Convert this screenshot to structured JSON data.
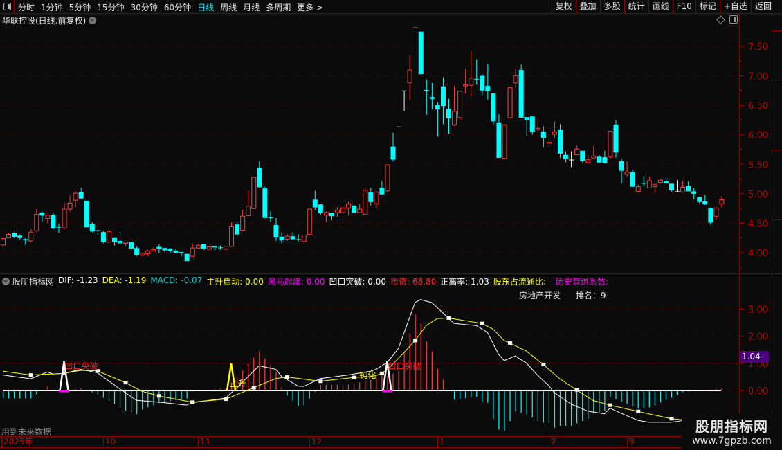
{
  "toolbar": {
    "periods": [
      "分时",
      "1分钟",
      "5分钟",
      "15分钟",
      "30分钟",
      "60分钟",
      "日线",
      "周线",
      "月线",
      "多周期",
      "更多 >"
    ],
    "active_period": "日线",
    "buttons": [
      "复权",
      "叠加",
      "多股",
      "统计",
      "画线",
      "F10",
      "标记",
      "+自选",
      "返回"
    ]
  },
  "main_panel": {
    "title": "华联控股(日线.前复权)"
  },
  "macd_panel": {
    "indicator_name": "股朋指标网",
    "fields": [
      {
        "label": "DIF: -1.23",
        "color": "#ffffff"
      },
      {
        "label": "DEA: -1.19",
        "color": "#ffff00"
      },
      {
        "label": "MACD: -0.07",
        "color": "#00c8c8"
      },
      {
        "label": "主升启动: 0.00",
        "color": "#ffff00"
      },
      {
        "label": "黑马起爆: 0.00",
        "color": "#ff00ff"
      },
      {
        "label": "凹口突破: 0.00",
        "color": "#ffffff"
      },
      {
        "label": "市值: 68.80",
        "color": "#ff2020"
      },
      {
        "label": "正离率: 1.03",
        "color": "#ffffff"
      },
      {
        "label": "股东占流通比: -",
        "color": "#ffff00"
      },
      {
        "label": "历史衰退系数: -",
        "color": "#ff00ff"
      }
    ],
    "sector": "房地产开发",
    "rank": "排名：9",
    "current_value_badge": "1.04",
    "future_data_note": "用到未来数据",
    "signal_labels": {
      "breakout": "凹口突破",
      "main_rise": "主升",
      "dulled": "钝化"
    }
  },
  "date_axis": [
    {
      "label": "2025年",
      "index": 0
    },
    {
      "label": "10",
      "index": 18
    },
    {
      "label": "11",
      "index": 35
    },
    {
      "label": "12",
      "index": 55
    },
    {
      "label": "1",
      "index": 78
    },
    {
      "label": "2",
      "index": 98
    },
    {
      "label": "3",
      "index": 112
    }
  ],
  "watermark": {
    "title": "股朋指标网",
    "url": "www.7gpzb.com"
  },
  "colors": {
    "up": "#ff3c3c",
    "down": "#00ffff",
    "flat": "#ffffff",
    "axis": "#c00000",
    "dif": "#ffffff",
    "dea": "#ffff00"
  },
  "chart_data": [
    {
      "type": "candlestick",
      "title": "华联控股(日线.前复权)",
      "y_ticks": [
        "7.50",
        "7.00",
        "6.50",
        "6.00",
        "5.50",
        "5.00",
        "4.50",
        "4.00"
      ],
      "ylim": [
        3.7,
        7.85
      ],
      "ohlc": [
        [
          4.13,
          4.25,
          4.1,
          4.24
        ],
        [
          4.25,
          4.34,
          4.25,
          4.31
        ],
        [
          4.33,
          4.35,
          4.25,
          4.27
        ],
        [
          4.29,
          4.31,
          4.23,
          4.25
        ],
        [
          4.23,
          4.25,
          4.14,
          4.21
        ],
        [
          4.2,
          4.4,
          4.18,
          4.35
        ],
        [
          4.37,
          4.74,
          4.35,
          4.65
        ],
        [
          4.68,
          4.7,
          4.53,
          4.63
        ],
        [
          4.58,
          4.64,
          4.5,
          4.64
        ],
        [
          4.64,
          4.68,
          4.4,
          4.41
        ],
        [
          4.43,
          4.49,
          4.34,
          4.42
        ],
        [
          4.42,
          4.85,
          4.4,
          4.74
        ],
        [
          4.74,
          4.97,
          4.7,
          4.84
        ],
        [
          4.89,
          5.04,
          4.77,
          5.01
        ],
        [
          5.03,
          5.1,
          4.92,
          4.92
        ],
        [
          4.88,
          4.88,
          4.43,
          4.43
        ],
        [
          4.49,
          4.52,
          4.35,
          4.36
        ],
        [
          4.38,
          4.42,
          4.3,
          4.37
        ],
        [
          4.35,
          4.37,
          4.16,
          4.18
        ],
        [
          4.18,
          4.4,
          4.16,
          4.36
        ],
        [
          4.25,
          4.25,
          4.12,
          4.18
        ],
        [
          4.2,
          4.35,
          4.13,
          4.16
        ],
        [
          4.16,
          4.18,
          4.11,
          4.18
        ],
        [
          4.18,
          4.18,
          4.05,
          4.07
        ],
        [
          4.08,
          4.11,
          3.94,
          3.96
        ],
        [
          3.96,
          4.0,
          3.94,
          3.99
        ],
        [
          3.98,
          4.05,
          3.94,
          4.03
        ],
        [
          4.03,
          4.09,
          4.03,
          4.05
        ],
        [
          4.1,
          4.14,
          3.99,
          4.07
        ],
        [
          4.08,
          4.08,
          4.01,
          4.04
        ],
        [
          4.07,
          4.08,
          4.0,
          4.03
        ],
        [
          4.03,
          4.06,
          3.99,
          4.0
        ],
        [
          4.01,
          4.01,
          3.94,
          3.99
        ],
        [
          3.98,
          3.98,
          3.86,
          3.86
        ],
        [
          3.94,
          4.16,
          3.93,
          4.08
        ],
        [
          4.08,
          4.15,
          4.06,
          4.12
        ],
        [
          4.15,
          4.15,
          4.05,
          4.07
        ],
        [
          4.06,
          4.11,
          4.05,
          4.1
        ],
        [
          4.11,
          4.12,
          4.05,
          4.09
        ],
        [
          4.09,
          4.12,
          4.05,
          4.08
        ],
        [
          4.06,
          4.12,
          4.05,
          4.11
        ],
        [
          4.11,
          4.52,
          4.1,
          4.44
        ],
        [
          4.48,
          4.53,
          4.29,
          4.31
        ],
        [
          4.38,
          4.73,
          4.36,
          4.62
        ],
        [
          4.63,
          5.06,
          4.62,
          4.79
        ],
        [
          4.75,
          5.28,
          4.74,
          5.28
        ],
        [
          5.44,
          5.55,
          5.11,
          5.11
        ],
        [
          5.09,
          5.12,
          4.59,
          4.59
        ],
        [
          4.6,
          4.7,
          4.53,
          4.59
        ],
        [
          4.47,
          4.59,
          4.2,
          4.26
        ],
        [
          4.27,
          4.35,
          4.16,
          4.21
        ],
        [
          4.23,
          4.32,
          4.2,
          4.28
        ],
        [
          4.28,
          4.35,
          4.21,
          4.23
        ],
        [
          4.23,
          4.31,
          4.19,
          4.22
        ],
        [
          4.19,
          4.3,
          4.18,
          4.3
        ],
        [
          4.31,
          4.74,
          4.3,
          4.74
        ],
        [
          4.9,
          5.05,
          4.72,
          4.77
        ],
        [
          4.82,
          4.82,
          4.64,
          4.67
        ],
        [
          4.64,
          4.7,
          4.52,
          4.68
        ],
        [
          4.68,
          4.68,
          4.55,
          4.62
        ],
        [
          4.68,
          4.77,
          4.61,
          4.72
        ],
        [
          4.68,
          4.81,
          4.49,
          4.76
        ],
        [
          4.76,
          4.87,
          4.63,
          4.83
        ],
        [
          4.8,
          4.82,
          4.68,
          4.68
        ],
        [
          4.68,
          4.83,
          4.68,
          4.74
        ],
        [
          4.65,
          5.1,
          4.65,
          5.06
        ],
        [
          5.03,
          5.1,
          4.8,
          4.86
        ],
        [
          4.83,
          5.03,
          4.75,
          5.03
        ],
        [
          5.1,
          5.22,
          4.99,
          4.99
        ],
        [
          5.05,
          5.49,
          5.03,
          5.49
        ],
        [
          5.8,
          6.04,
          5.55,
          5.58
        ],
        [
          6.14,
          6.14,
          6.14,
          6.14
        ],
        [
          6.75,
          6.75,
          6.41,
          6.75
        ],
        [
          6.88,
          7.35,
          6.6,
          7.1
        ],
        [
          7.82,
          7.82,
          7.82,
          7.82
        ],
        [
          7.75,
          7.75,
          7.03,
          7.03
        ],
        [
          6.76,
          6.94,
          6.34,
          6.75
        ],
        [
          6.64,
          6.88,
          6.43,
          6.61
        ],
        [
          6.5,
          6.55,
          5.97,
          6.43
        ],
        [
          6.82,
          6.98,
          6.18,
          6.49
        ],
        [
          6.44,
          6.61,
          6.02,
          6.28
        ],
        [
          6.17,
          6.83,
          6.15,
          6.4
        ],
        [
          6.29,
          6.74,
          6.25,
          6.74
        ],
        [
          6.83,
          7.12,
          6.7,
          6.85
        ],
        [
          6.84,
          7.43,
          6.65,
          6.96
        ],
        [
          6.95,
          7.28,
          6.85,
          6.94
        ],
        [
          7.0,
          7.03,
          6.67,
          6.75
        ],
        [
          6.83,
          7.2,
          6.6,
          6.74
        ],
        [
          6.7,
          6.7,
          6.17,
          6.23
        ],
        [
          6.21,
          6.35,
          5.61,
          5.61
        ],
        [
          5.6,
          6.17,
          5.58,
          6.17
        ],
        [
          6.29,
          6.8,
          6.29,
          6.8
        ],
        [
          6.88,
          7.12,
          6.8,
          7.0
        ],
        [
          7.1,
          7.19,
          6.29,
          6.29
        ],
        [
          6.3,
          6.3,
          5.98,
          6.25
        ],
        [
          6.31,
          6.31,
          6.0,
          6.05
        ],
        [
          6.09,
          6.3,
          6.03,
          6.11
        ],
        [
          6.05,
          6.14,
          5.79,
          5.95
        ],
        [
          5.86,
          6.02,
          5.79,
          5.87
        ],
        [
          6.01,
          6.23,
          5.95,
          6.05
        ],
        [
          6.08,
          6.18,
          5.61,
          5.68
        ],
        [
          5.66,
          5.72,
          5.53,
          5.59
        ],
        [
          5.58,
          5.72,
          5.45,
          5.58
        ],
        [
          5.66,
          5.82,
          5.66,
          5.76
        ],
        [
          5.73,
          5.73,
          5.53,
          5.56
        ],
        [
          5.53,
          5.66,
          5.51,
          5.58
        ],
        [
          5.61,
          5.81,
          5.6,
          5.64
        ],
        [
          5.63,
          5.66,
          5.52,
          5.53
        ],
        [
          5.62,
          5.73,
          5.51,
          5.52
        ],
        [
          5.63,
          6.06,
          5.59,
          6.06
        ],
        [
          6.17,
          6.25,
          5.61,
          5.7
        ],
        [
          5.55,
          5.59,
          5.18,
          5.39
        ],
        [
          5.33,
          5.55,
          5.29,
          5.37
        ],
        [
          5.37,
          5.41,
          5.11,
          5.12
        ],
        [
          5.04,
          5.15,
          5.03,
          5.12
        ],
        [
          5.18,
          5.3,
          5.12,
          5.17
        ],
        [
          5.1,
          5.29,
          5.1,
          5.22
        ],
        [
          5.12,
          5.17,
          5.01,
          5.16
        ],
        [
          5.19,
          5.25,
          5.17,
          5.23
        ],
        [
          5.21,
          5.27,
          5.18,
          5.18
        ],
        [
          5.17,
          5.17,
          5.04,
          5.06
        ],
        [
          5.04,
          5.23,
          5.04,
          5.04
        ],
        [
          5.03,
          5.22,
          5.03,
          5.11
        ],
        [
          5.13,
          5.21,
          5.04,
          5.04
        ],
        [
          5.04,
          5.09,
          4.9,
          5.0
        ],
        [
          4.94,
          4.95,
          4.84,
          4.86
        ],
        [
          4.87,
          4.98,
          4.81,
          4.82
        ],
        [
          4.76,
          4.76,
          4.47,
          4.51
        ],
        [
          4.62,
          4.76,
          4.55,
          4.76
        ],
        [
          4.83,
          4.96,
          4.76,
          4.9
        ]
      ]
    },
    {
      "type": "line",
      "title": "股朋指标网 MACD",
      "y_ticks": [
        "3.00",
        "2.00",
        "1.00",
        "0.00"
      ],
      "ylim": [
        -1.7,
        3.5
      ],
      "dif_points": [
        [
          0,
          0.57
        ],
        [
          5,
          0.43
        ],
        [
          8,
          0.68
        ],
        [
          9,
          0.61
        ],
        [
          11,
          0.63
        ],
        [
          14,
          0.78
        ],
        [
          17,
          0.65
        ],
        [
          21,
          0.06
        ],
        [
          24,
          -0.36
        ],
        [
          29,
          -0.45
        ],
        [
          33,
          -0.54
        ],
        [
          34,
          -0.45
        ],
        [
          40,
          -0.28
        ],
        [
          42,
          0.1
        ],
        [
          46,
          0.91
        ],
        [
          49,
          0.78
        ],
        [
          50,
          0.53
        ],
        [
          53.5,
          0.1
        ],
        [
          57,
          0.44
        ],
        [
          62,
          0.57
        ],
        [
          66.6,
          0.73
        ],
        [
          69,
          1.03
        ],
        [
          71,
          1.54
        ],
        [
          74,
          3.24
        ],
        [
          75,
          3.35
        ],
        [
          77,
          3.24
        ],
        [
          79,
          2.86
        ],
        [
          81,
          2.47
        ],
        [
          83,
          2.43
        ],
        [
          85,
          2.39
        ],
        [
          87,
          2.14
        ],
        [
          89,
          1.33
        ],
        [
          90,
          1.1
        ],
        [
          92,
          1.27
        ],
        [
          94,
          1.01
        ],
        [
          96,
          0.56
        ],
        [
          98,
          0.18
        ],
        [
          99,
          -0.08
        ],
        [
          102,
          -0.5
        ],
        [
          105,
          -0.76
        ],
        [
          108,
          -0.86
        ],
        [
          109,
          -0.65
        ],
        [
          111,
          -0.84
        ],
        [
          114,
          -1.1
        ],
        [
          116,
          -1.17
        ],
        [
          120,
          -1.17
        ],
        [
          122,
          -1.11
        ],
        [
          125,
          -1.1
        ],
        [
          129,
          -1.05
        ]
      ],
      "dea_points": [
        [
          0,
          0.71
        ],
        [
          5,
          0.57
        ],
        [
          11,
          0.63
        ],
        [
          14,
          0.74
        ],
        [
          17,
          0.72
        ],
        [
          22,
          0.29
        ],
        [
          25,
          -0.03
        ],
        [
          28,
          -0.2
        ],
        [
          34,
          -0.43
        ],
        [
          40,
          -0.32
        ],
        [
          45,
          0.1
        ],
        [
          49,
          0.44
        ],
        [
          51,
          0.5
        ],
        [
          57,
          0.34
        ],
        [
          63,
          0.48
        ],
        [
          66.6,
          0.52
        ],
        [
          68,
          0.63
        ],
        [
          69,
          0.77
        ],
        [
          71.5,
          1.28
        ],
        [
          74,
          1.84
        ],
        [
          76,
          2.39
        ],
        [
          78,
          2.65
        ],
        [
          80,
          2.67
        ],
        [
          86,
          2.47
        ],
        [
          88,
          2.26
        ],
        [
          90,
          1.84
        ],
        [
          91,
          1.75
        ],
        [
          94,
          1.45
        ],
        [
          97,
          0.96
        ],
        [
          100,
          0.43
        ],
        [
          103,
          0.02
        ],
        [
          106,
          -0.37
        ],
        [
          109,
          -0.54
        ],
        [
          114,
          -0.77
        ],
        [
          120,
          -1.04
        ],
        [
          122,
          -1.08
        ],
        [
          125,
          -1.1
        ],
        [
          129,
          -1.09
        ]
      ],
      "histogram": "2*(DIF-DEA)",
      "signals": [
        {
          "type": "breakout",
          "index": 11
        },
        {
          "type": "main_rise",
          "index": 41
        },
        {
          "type": "breakout",
          "index": 69
        }
      ],
      "dulled_label_index": 64
    }
  ]
}
